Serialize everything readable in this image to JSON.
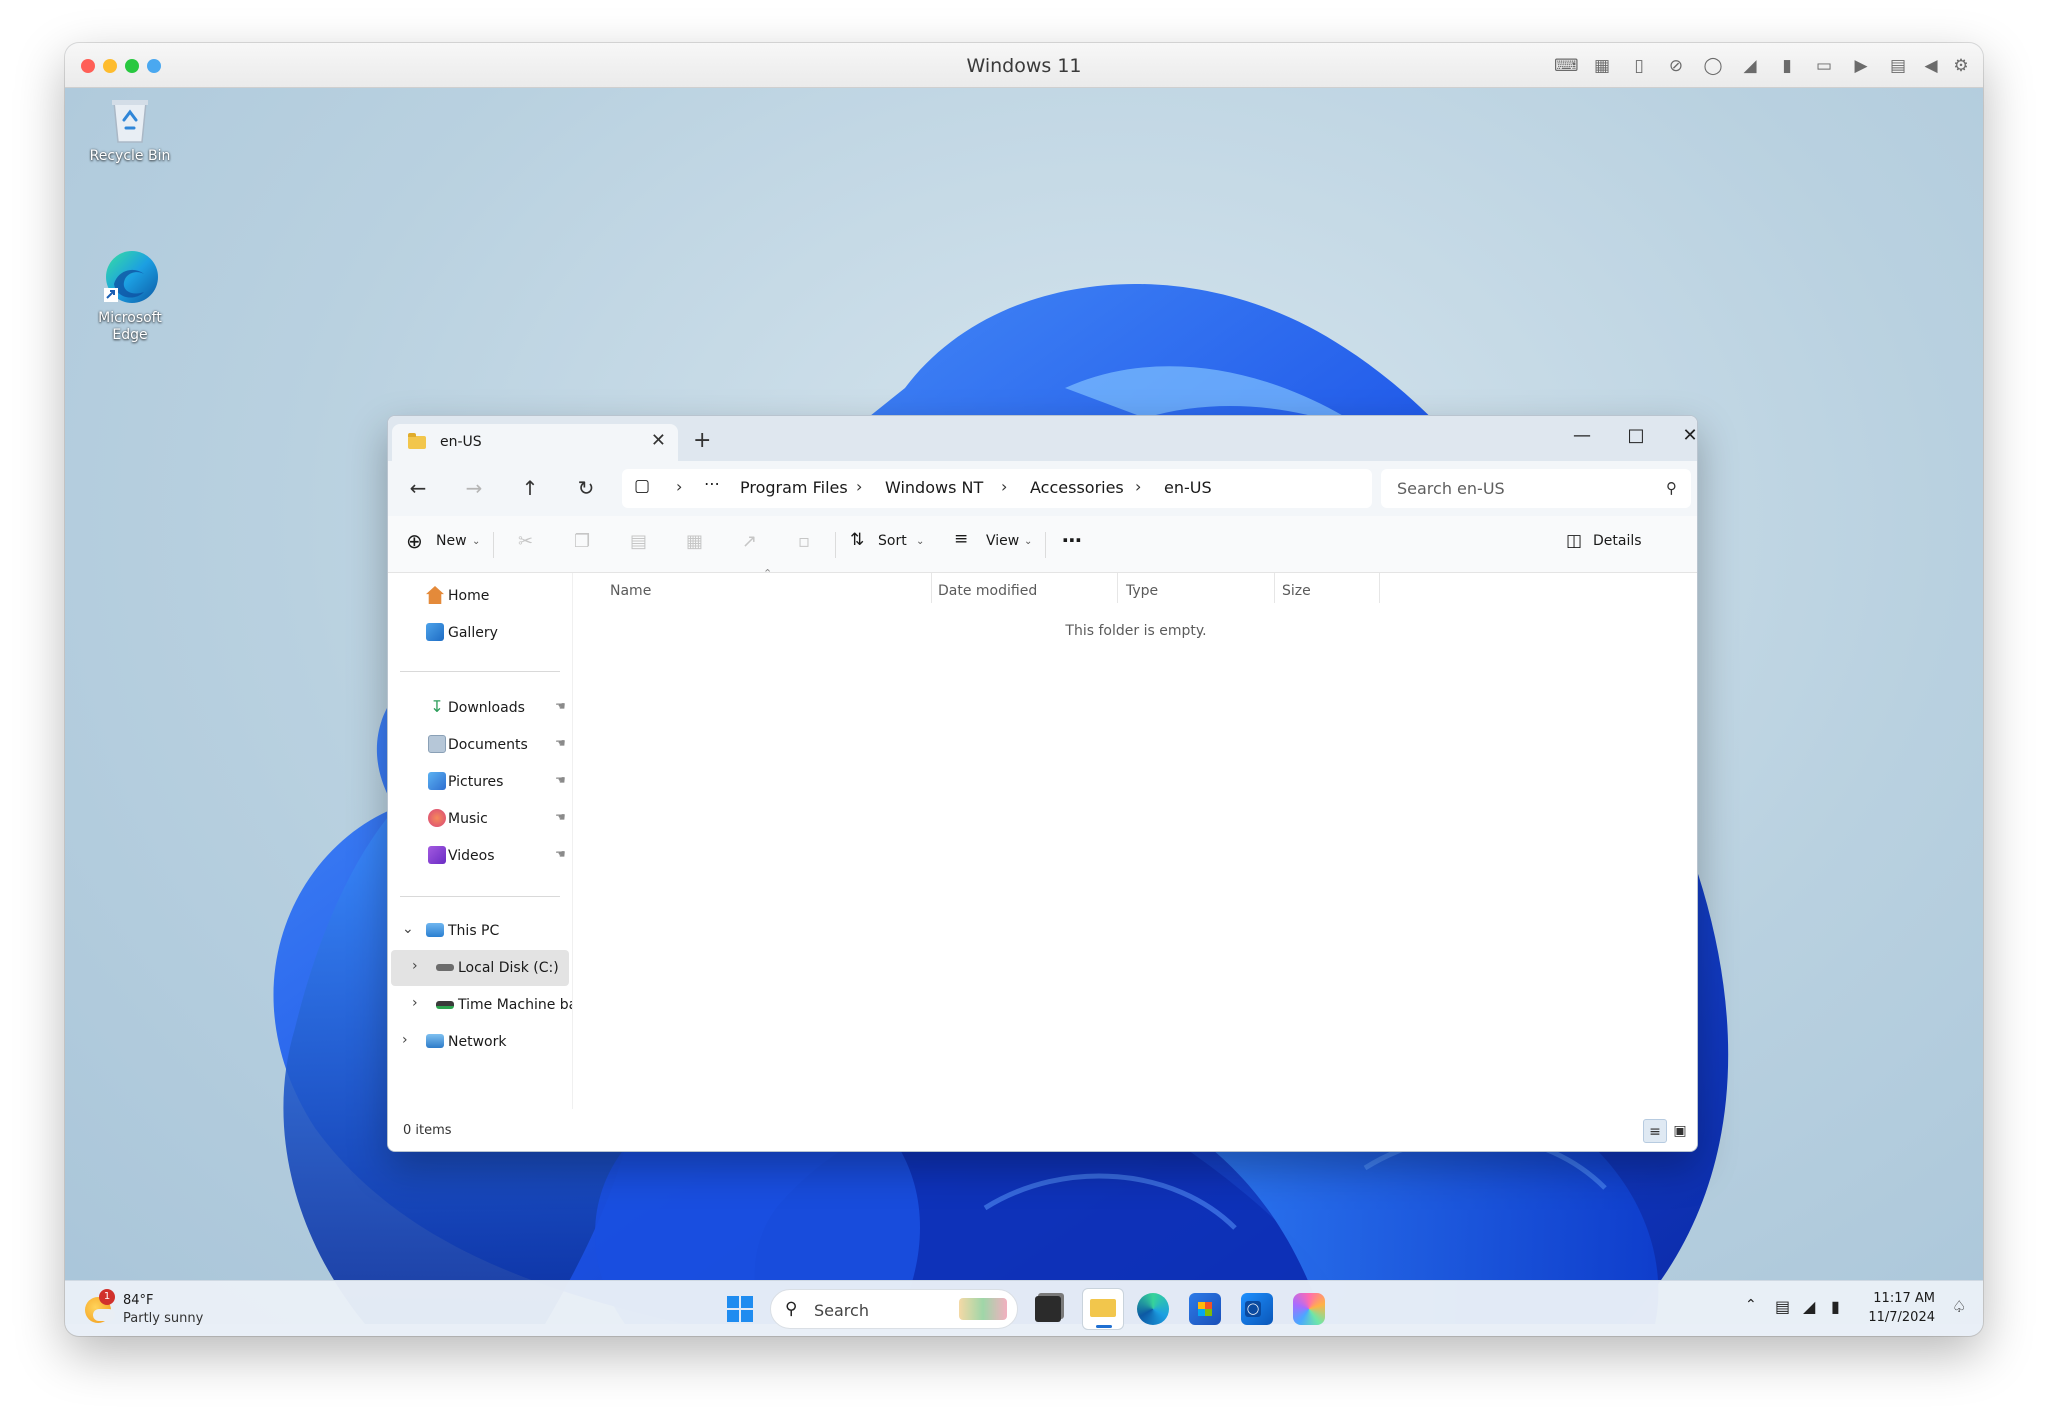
{
  "vm": {
    "title": "Windows 11"
  },
  "desktop": {
    "icons": [
      {
        "label": "Recycle Bin"
      },
      {
        "label_line1": "Microsoft",
        "label_line2": "Edge"
      }
    ]
  },
  "explorer": {
    "tab_title": "en-US",
    "address": {
      "ellipsis": "⋯",
      "segments": [
        "Program Files",
        "Windows NT",
        "Accessories",
        "en-US"
      ]
    },
    "search_placeholder": "Search en-US",
    "toolbar": {
      "new": "New",
      "sort": "Sort",
      "view": "View",
      "more": "⋯",
      "details": "Details"
    },
    "nav": {
      "quick": [
        "Home",
        "Gallery"
      ],
      "pinned": [
        "Downloads",
        "Documents",
        "Pictures",
        "Music",
        "Videos"
      ],
      "this_pc": "This PC",
      "drives": [
        "Local Disk (C:)",
        "Time Machine bac"
      ],
      "network": "Network"
    },
    "columns": [
      "Name",
      "Date modified",
      "Type",
      "Size"
    ],
    "empty_message": "This folder is empty.",
    "status": "0 items"
  },
  "taskbar": {
    "weather": {
      "temp": "84°F",
      "condition": "Partly sunny",
      "badge": "1"
    },
    "search_placeholder": "Search",
    "clock": {
      "time": "11:17 AM",
      "date": "11/7/2024"
    }
  }
}
